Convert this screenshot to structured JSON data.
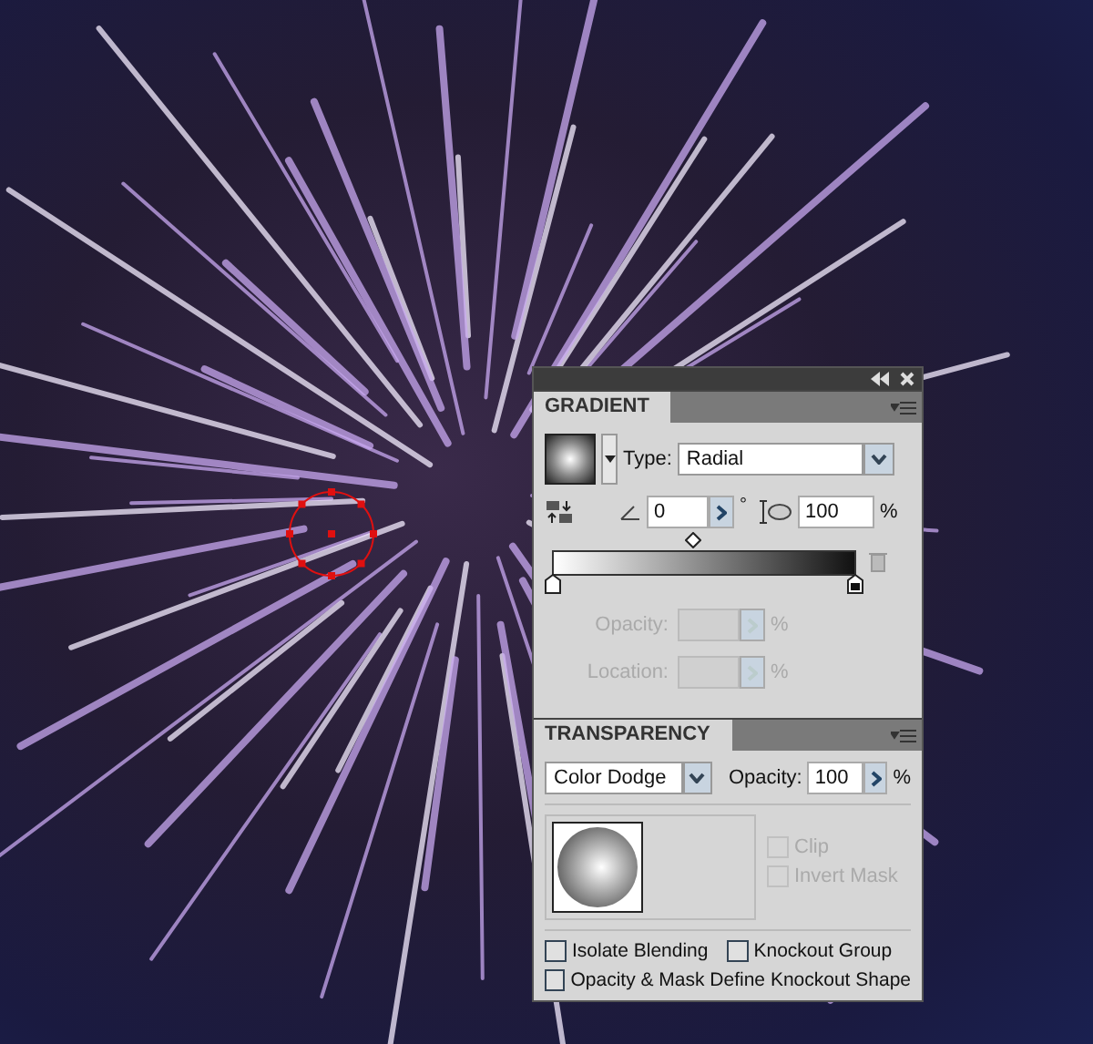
{
  "gradient_panel": {
    "title": "GRADIENT",
    "type_label": "Type:",
    "type_value": "Radial",
    "angle_value": "0",
    "degree_sign": "°",
    "aspect_value": "100",
    "aspect_unit": "%",
    "opacity_label": "Opacity:",
    "opacity_unit": "%",
    "location_label": "Location:",
    "location_unit": "%",
    "stop_fields_disabled": true
  },
  "transparency_panel": {
    "title": "TRANSPARENCY",
    "blend_mode": "Color Dodge",
    "opacity_label": "Opacity:",
    "opacity_value": "100",
    "opacity_unit": "%",
    "mask_options": [
      {
        "label": "Clip",
        "checked": false,
        "disabled": true
      },
      {
        "label": "Invert Mask",
        "checked": false,
        "disabled": true
      }
    ],
    "options": [
      {
        "label": "Isolate Blending",
        "checked": false
      },
      {
        "label": "Knockout Group",
        "checked": false
      },
      {
        "label": "Opacity & Mask Define Knockout Shape",
        "checked": false
      }
    ]
  }
}
